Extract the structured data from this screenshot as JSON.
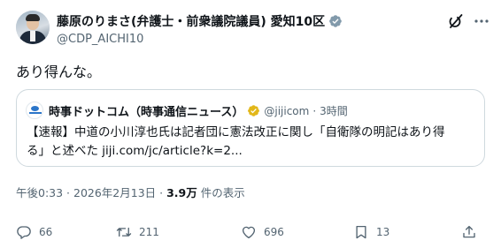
{
  "author": {
    "display_name": "藤原のりまさ(弁護士・前衆議院議員) 愛知10区",
    "handle": "@CDP_AICHI10"
  },
  "icons": {
    "verified": "verified-badge-icon",
    "grok": "grok-icon",
    "more": "more-icon",
    "reply": "reply-icon",
    "retweet": "retweet-icon",
    "like": "like-icon",
    "bookmark": "bookmark-icon",
    "share": "share-icon"
  },
  "colors": {
    "verified_gray": "#829aab",
    "verified_gold": "#e2b719",
    "muted_text": "#536471",
    "border": "#cfd9de"
  },
  "tweet": {
    "text": "あり得んな。"
  },
  "quote": {
    "name": "時事ドットコム（時事通信ニュース）",
    "handle": "@jijicom",
    "separator": "·",
    "time": "3時間",
    "line1": "【速報】中道の小川淳也氏は記者団に憲法改正に関し「自衛隊の明記はあり得",
    "line2_prefix": "る」と述べた ",
    "line2_link": "jiji.com/jc/article?k=2..."
  },
  "meta": {
    "time": "午後0:33 · 2026年2月13日 · ",
    "views": "3.9万",
    "views_label": " 件の表示"
  },
  "stats": {
    "replies": "66",
    "retweets": "211",
    "likes": "696",
    "bookmarks": "13"
  }
}
